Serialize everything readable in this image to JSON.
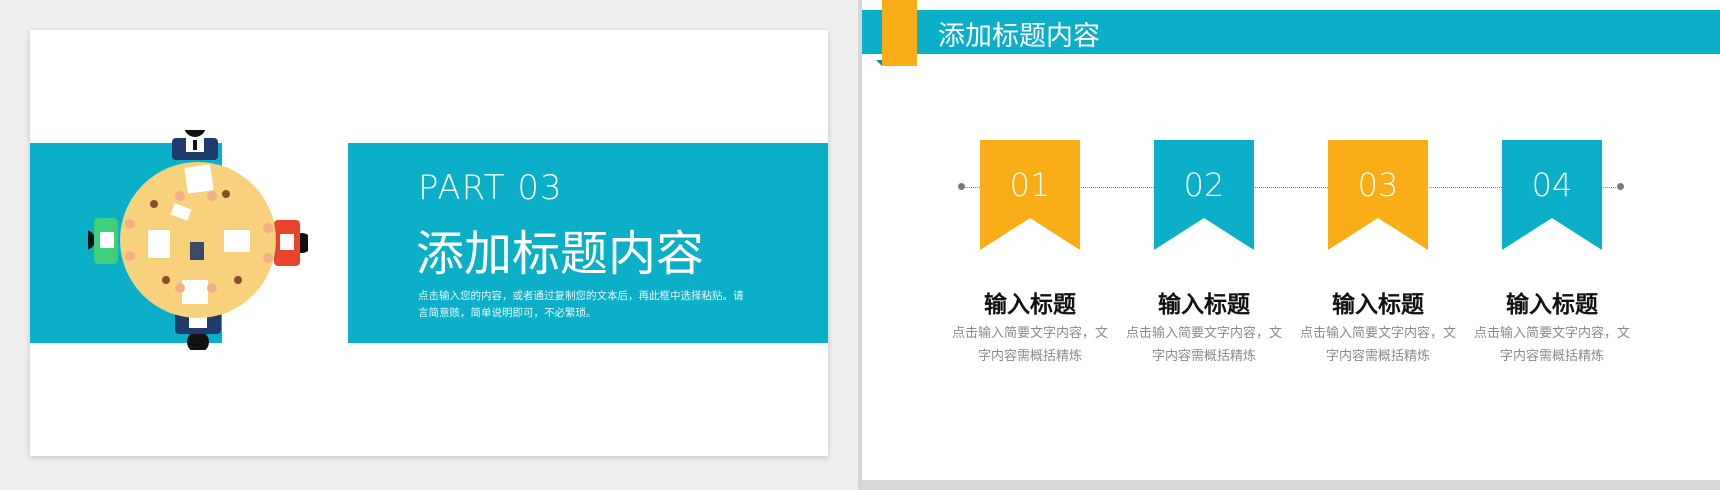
{
  "left_slide": {
    "part_label": "PART 03",
    "title": "添加标题内容",
    "description": "点击输入您的内容，或者通过复制您的文本后，再此框中选择粘贴。请言简意赅，简单说明即可，不必繁琐。"
  },
  "right_slide": {
    "header_title": "添加标题内容",
    "steps": [
      {
        "number": "01",
        "title": "输入标题",
        "desc": "点击输入简要文字内容，文字内容需概括精炼",
        "color": "#f9ad16"
      },
      {
        "number": "02",
        "title": "输入标题",
        "desc": "点击输入简要文字内容，文字内容需概括精炼",
        "color": "#0bafc8"
      },
      {
        "number": "03",
        "title": "输入标题",
        "desc": "点击输入简要文字内容，文字内容需概括精炼",
        "color": "#f9ad16"
      },
      {
        "number": "04",
        "title": "输入标题",
        "desc": "点击输入简要文字内容，文字内容需概括精炼",
        "color": "#0bafc8"
      }
    ]
  },
  "colors": {
    "accent_blue": "#0bafc8",
    "accent_orange": "#f9ad16"
  },
  "icons": {
    "illustration": "meeting-table-icon"
  }
}
